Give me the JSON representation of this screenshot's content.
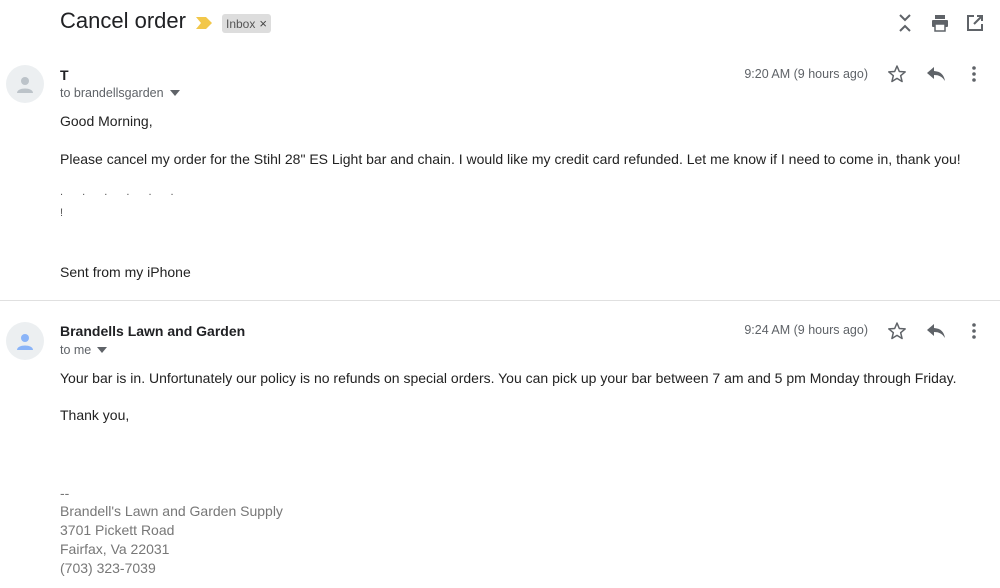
{
  "subject": "Cancel order",
  "label_chip": {
    "text": "Inbox",
    "close": "×"
  },
  "messages": [
    {
      "sender": "T",
      "recipient": "to brandellsgarden",
      "time": "9:20 AM (9 hours ago)",
      "body": [
        "Good Morning,",
        "Please cancel my order for the Stihl 28\" ES Light bar and chain.  I would like my credit card refunded.  Let me know if I need to come in, thank you!"
      ],
      "redacted_1": ". . . . . .",
      "redacted_2": "!",
      "signature": "Sent from my iPhone"
    },
    {
      "sender": "Brandells Lawn and Garden",
      "recipient": "to me",
      "time": "9:24 AM (9 hours ago)",
      "body": [
        "Your bar is in. Unfortunately our policy is no refunds on special orders. You can pick up your bar between 7 am and 5 pm Monday through Friday.",
        "Thank you,"
      ],
      "signature": [
        "--",
        "Brandell's Lawn and Garden Supply",
        "3701 Pickett Road",
        "Fairfax, Va 22031",
        "(703) 323-7039"
      ]
    }
  ],
  "icons": {
    "collapse": "collapse-all-icon",
    "print": "print-icon",
    "popout": "open-in-new-window-icon",
    "star": "star-icon",
    "reply": "reply-icon",
    "more": "more-vert-icon"
  },
  "colors": {
    "importance_marker": "#f2c74a",
    "chip_bg": "#dddddd"
  }
}
